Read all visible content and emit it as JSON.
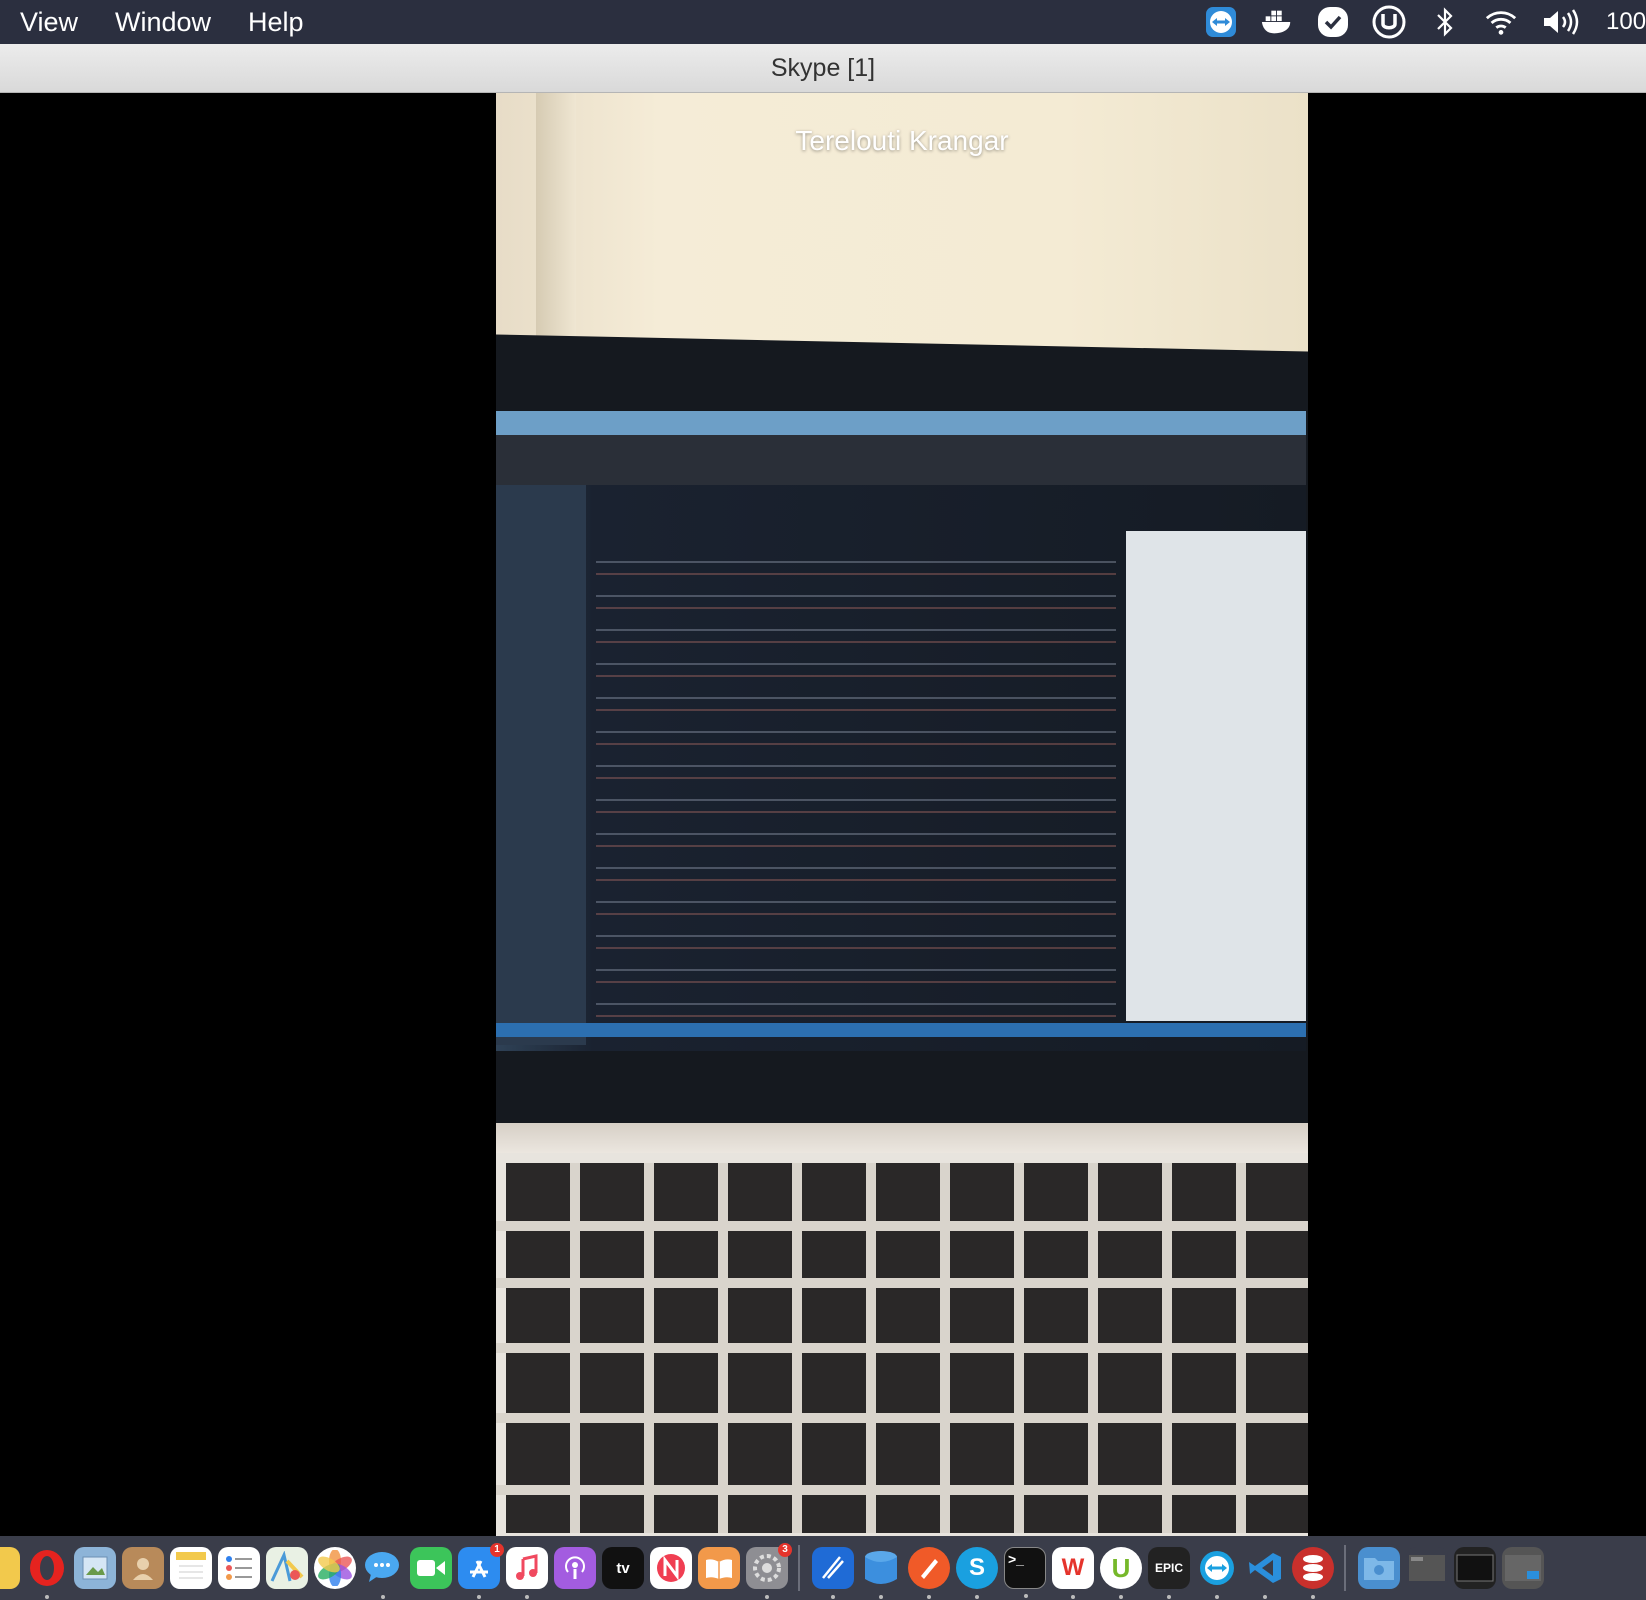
{
  "menubar": {
    "items": [
      "View",
      "Window",
      "Help"
    ],
    "battery": "100",
    "status_icons": [
      "teamviewer-icon",
      "docker-icon",
      "checkmark-icon",
      "utorrent-icon",
      "bluetooth-icon",
      "wifi-icon",
      "volume-icon"
    ]
  },
  "window": {
    "title": "Skype [1]"
  },
  "call": {
    "caller_name": "Terelouti Krangar"
  },
  "dock": {
    "apps": [
      {
        "name": "finder-icon"
      },
      {
        "name": "opera-icon"
      },
      {
        "name": "preview-icon"
      },
      {
        "name": "contacts-icon"
      },
      {
        "name": "notes-icon"
      },
      {
        "name": "reminders-icon"
      },
      {
        "name": "maps-icon"
      },
      {
        "name": "photos-icon"
      },
      {
        "name": "messages-icon"
      },
      {
        "name": "facetime-icon"
      },
      {
        "name": "app-store-icon",
        "badge": "1"
      },
      {
        "name": "music-icon"
      },
      {
        "name": "podcasts-icon"
      },
      {
        "name": "tv-icon",
        "label": "tv"
      },
      {
        "name": "news-icon"
      },
      {
        "name": "books-icon"
      },
      {
        "name": "system-preferences-icon",
        "badge": "3"
      },
      {
        "name": "xcode-icon"
      },
      {
        "name": "database-icon"
      },
      {
        "name": "pen-icon"
      },
      {
        "name": "skype-icon",
        "label": "S"
      },
      {
        "name": "terminal-icon",
        "label": ">_"
      },
      {
        "name": "wps-icon",
        "label": "W"
      },
      {
        "name": "utorrent-dock-icon",
        "label": "U"
      },
      {
        "name": "epic-games-icon",
        "label": "EPIC"
      },
      {
        "name": "teamviewer-dock-icon"
      },
      {
        "name": "vscode-icon"
      },
      {
        "name": "stack-icon"
      }
    ],
    "accent": "#2b2f3f"
  }
}
